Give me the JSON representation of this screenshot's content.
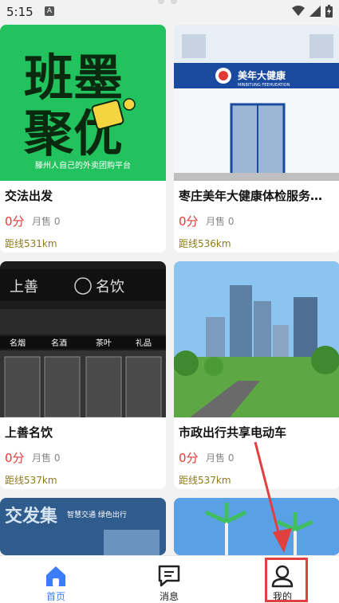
{
  "status": {
    "time": "5:15",
    "notif_badge": "A"
  },
  "cards": [
    {
      "title": "交法出发",
      "price": "0分",
      "sales": "月售 0",
      "distance": "距线531km",
      "image": {
        "line1": "班墨",
        "line2": "聚优",
        "tagline": "滕州人自己的外卖团购平台",
        "bg": "#1db954"
      }
    },
    {
      "title": "枣庄美年大健康体检服务…",
      "price": "0分",
      "sales": "月售 0",
      "distance": "距线536km",
      "image": {
        "sign": "美年大健康",
        "sign_sub": "MINBITUNG FEEHUEATION",
        "bg": "#1a4aa0"
      }
    },
    {
      "title": "上善名饮",
      "price": "0分",
      "sales": "月售 0",
      "distance": "距线537km",
      "image": {
        "sign": "上善",
        "sign2": "名饮",
        "panels": [
          "名烟",
          "名酒",
          "茶叶",
          "礼品"
        ],
        "bg": "#222222"
      }
    },
    {
      "title": "市政出行共享电动车",
      "price": "0分",
      "sales": "月售 0",
      "distance": "距线537km",
      "image": {
        "bg": "#6fb0e8"
      }
    },
    {
      "title": "",
      "price": "",
      "sales": "",
      "distance": "",
      "image": {
        "text": "交发集",
        "sub": "智慧交通 绿色出行",
        "bg": "#3c6ba0"
      }
    },
    {
      "title": "",
      "price": "",
      "sales": "",
      "distance": "",
      "image": {
        "bg": "#4a90d9"
      }
    }
  ],
  "tabs": [
    {
      "label": "首页",
      "icon": "home-icon",
      "active": true
    },
    {
      "label": "消息",
      "icon": "message-icon",
      "active": false
    },
    {
      "label": "我的",
      "icon": "user-icon",
      "active": false
    }
  ],
  "colors": {
    "accent": "#3b7cff",
    "price": "#e53935",
    "annotation": "#e04040"
  }
}
